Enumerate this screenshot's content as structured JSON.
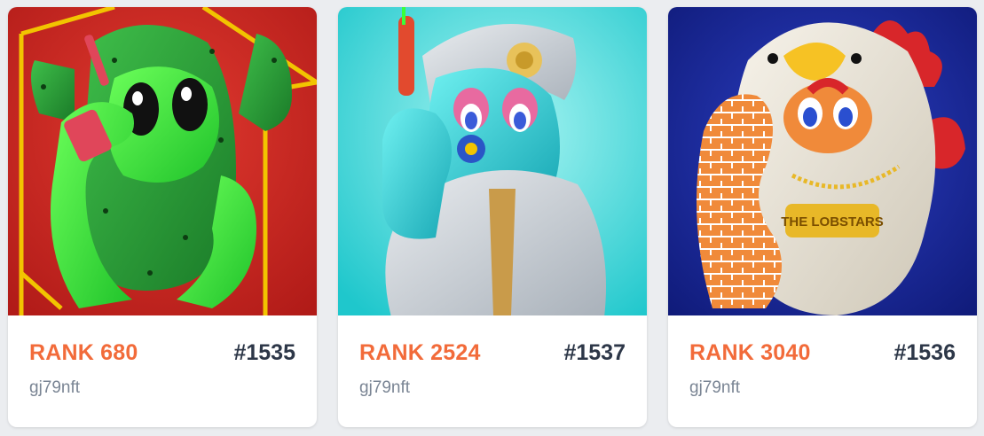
{
  "cards": [
    {
      "rank_label": "RANK 680",
      "token_id": "#1535",
      "owner": "gj79nft",
      "art": "green-cactus-character",
      "bg_color": "#d42a24"
    },
    {
      "rank_label": "RANK 2524",
      "token_id": "#1537",
      "owner": "gj79nft",
      "art": "cyan-character-captain-hat",
      "bg_color": "#35d4d6"
    },
    {
      "rank_label": "RANK 3040",
      "token_id": "#1536",
      "owner": "gj79nft",
      "art": "chicken-costume-character",
      "bg_color": "#17249a",
      "art_text": "THE LOBSTARS"
    }
  ],
  "colors": {
    "rank": "#f26b3a",
    "token": "#2d3748",
    "owner": "#7a8594"
  }
}
